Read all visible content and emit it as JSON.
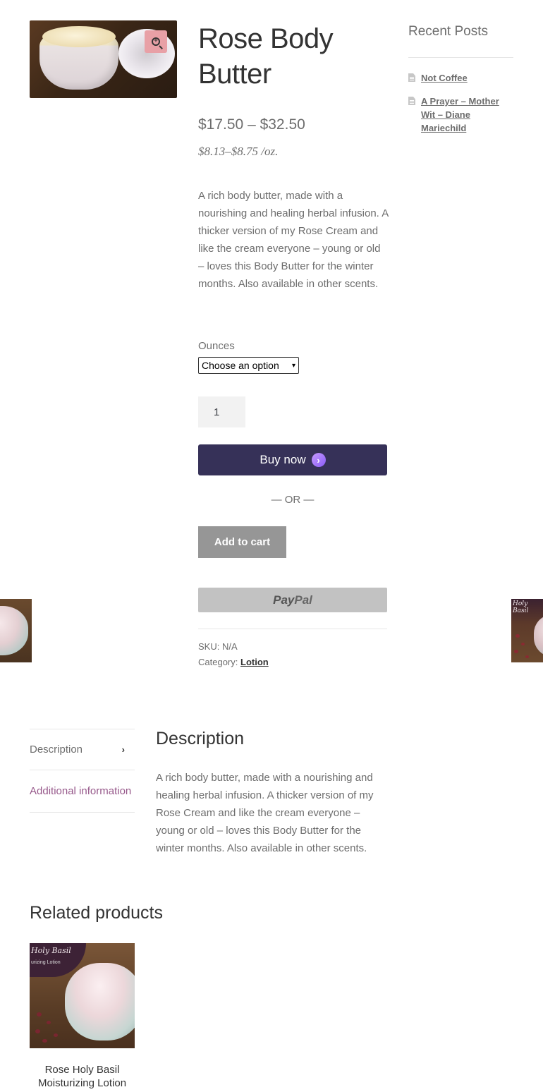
{
  "product": {
    "title": "Rose Body Butter",
    "price_range": "$17.50 – $32.50",
    "unit_price": "$8.13–$8.75 /oz.",
    "short_description": "A rich body butter, made with a nourishing and healing herbal infusion. A thicker version of my Rose Cream and like the cream everyone – young or old – loves this Body Butter for the winter months. Also available in other scents.",
    "variation_label": "Ounces",
    "variation_selected": "Choose an option",
    "quantity": "1",
    "buy_now_label": "Buy now",
    "or_label": "— OR —",
    "add_to_cart_label": "Add to cart",
    "paypal_pay": "Pay",
    "paypal_pal": "Pal",
    "sku_label": "SKU: N/A",
    "category_label": "Category:",
    "category_value": "Lotion"
  },
  "sidebar": {
    "title": "Recent Posts",
    "posts": [
      {
        "label": "Not Coffee"
      },
      {
        "label": "A Prayer – Mother Wit – Diane Mariechild"
      }
    ]
  },
  "tabs": {
    "description_tab": "Description",
    "additional_tab": "Additional information",
    "description_heading": "Description",
    "description_body": "A rich body butter, made with a nourishing and healing herbal infusion. A thicker version of my Rose Cream and like the cream everyone – young or old – loves this Body Butter for the winter months. Also available in other scents."
  },
  "related": {
    "heading": "Related products",
    "items": [
      {
        "name": "Rose Holy Basil Moisturizing Lotion",
        "image_text": "Holy Basil",
        "image_subtext": "urizing Lotion"
      }
    ]
  },
  "nav_thumbs": {
    "next_text": "Holy Basil"
  },
  "icons": {
    "zoom": "zoom-in-icon",
    "post": "document-icon",
    "tab_chevron": "chevron-right-icon",
    "buy_now_arrow": "arrow-right-icon"
  },
  "colors": {
    "buy_now_bg": "#363158",
    "add_to_cart_bg": "#969696",
    "paypal_bg": "#c2c2c2",
    "zoom_bg": "#e8a0a6",
    "link_accent": "#96588a"
  }
}
